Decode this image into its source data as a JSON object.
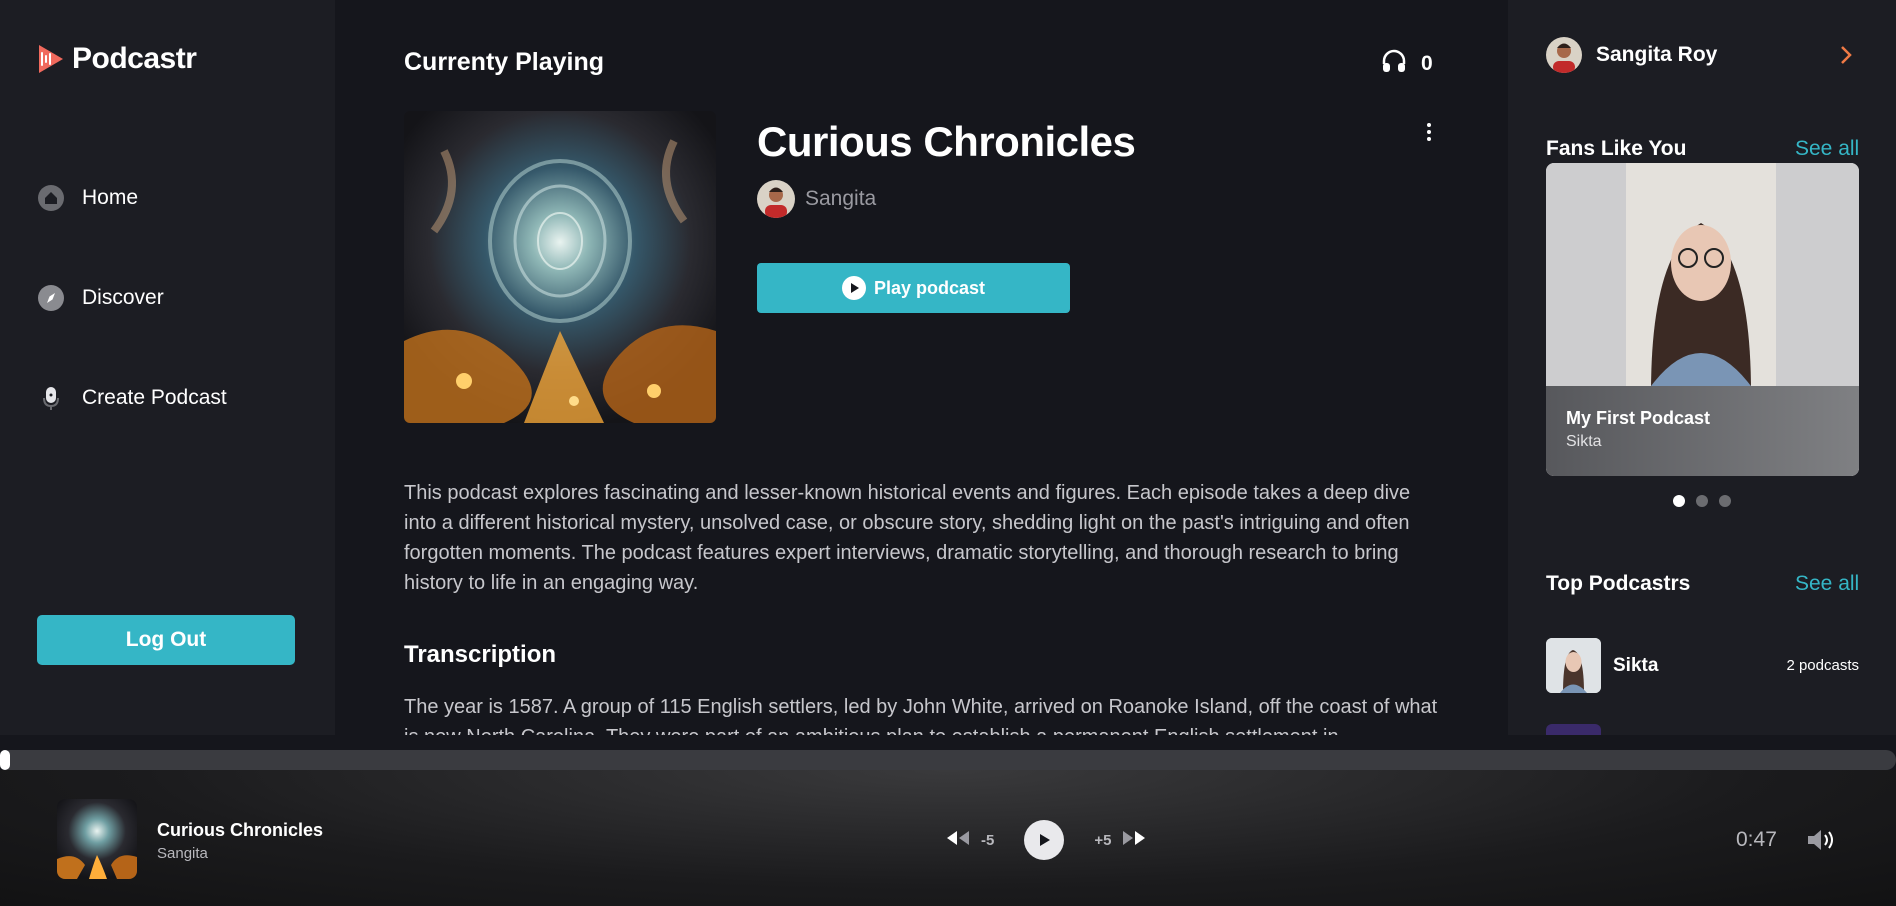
{
  "app": {
    "name": "Podcastr"
  },
  "nav": [
    {
      "label": "Home",
      "icon": "home-icon"
    },
    {
      "label": "Discover",
      "icon": "compass-icon"
    },
    {
      "label": "Create Podcast",
      "icon": "microphone-icon"
    }
  ],
  "logout_label": "Log Out",
  "main": {
    "section_title": "Currenty Playing",
    "listeners_count": "0",
    "podcast_title": "Curious Chronicles",
    "author": "Sangita",
    "play_label": "Play podcast",
    "description": "This podcast explores fascinating and lesser-known historical events and figures. Each episode takes a deep dive into a different historical mystery, unsolved case, or obscure story, shedding light on the past's intriguing and often forgotten moments. The podcast features expert interviews, dramatic storytelling, and thorough research to bring history to life in an engaging way.",
    "transcription_title": "Transcription",
    "transcription": "The year is 1587. A group of 115 English settlers, led by John White, arrived on Roanoke Island, off the coast of what is now North Carolina. They were part of an ambitious plan to establish a permanent English settlement in"
  },
  "right": {
    "user_name": "Sangita Roy",
    "fans_title": "Fans Like You",
    "see_all": "See all",
    "fan_card": {
      "title": "My First Podcast",
      "author": "Sikta"
    },
    "carousel_active": 0,
    "carousel_count": 3,
    "top_title": "Top Podcastrs",
    "top_podcastrs": [
      {
        "name": "Sikta",
        "count": "2 podcasts"
      }
    ]
  },
  "player": {
    "title": "Curious Chronicles",
    "author": "Sangita",
    "rewind_label": "-5",
    "forward_label": "+5",
    "time": "0:47",
    "progress_fraction": 0.005
  },
  "colors": {
    "accent": "#35b6c6",
    "brand": "#f0695d",
    "chevron": "#f07a45"
  }
}
